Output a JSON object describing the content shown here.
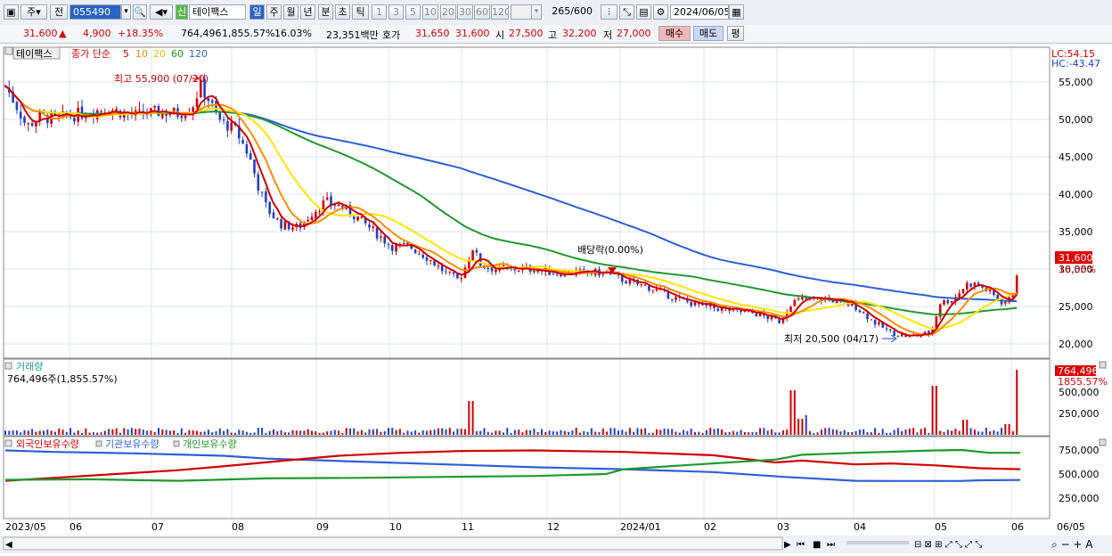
{
  "toolbar": {
    "type_label": "주",
    "prev_label": "전",
    "code_value": "055490",
    "new_label": "신",
    "stock_name": "테이팩스",
    "periods": [
      "일",
      "주",
      "월",
      "년",
      "분",
      "초",
      "틱"
    ],
    "intervals": [
      "1",
      "3",
      "5",
      "10",
      "20",
      "30",
      "60",
      "120"
    ],
    "count": "265",
    "count_total": "/600",
    "date": "2024/06/05"
  },
  "info": {
    "price": "31,600",
    "change_arrow": "▲",
    "change": "4,900",
    "change_pct": "+18.35%",
    "volume": "764,496",
    "volume_pct": "1,855.57%",
    "turnover": "16.03%",
    "amount": "23,351백만",
    "quote_label": "호가",
    "ask": "31,650",
    "bid": "31,600",
    "open_label": "시",
    "open": "27,500",
    "high_label": "고",
    "high": "32,200",
    "low_label": "저",
    "low": "27,000",
    "buy_label": "매수",
    "sell_label": "매도",
    "avg_label": "평"
  },
  "price_panel": {
    "name": "테이팩스",
    "legend_prefix": "종가 단순",
    "ma": [
      {
        "label": "5",
        "color": "#d00000"
      },
      {
        "label": "10",
        "color": "#e6a000"
      },
      {
        "label": "20",
        "color": "#e6d600"
      },
      {
        "label": "60",
        "color": "#1a9a1a"
      },
      {
        "label": "120",
        "color": "#2e5fd8"
      }
    ],
    "lc": "LC:54.15",
    "hc": "HC:-43.47",
    "high_note": "최고 55,900 (07/20)",
    "low_note": "최저 20,500 (04/17)",
    "div_note": "배당락(0.00%)",
    "current_price": "31,600",
    "current_pct": "18.35%",
    "y_ticks": [
      "55,000",
      "50,000",
      "45,000",
      "40,000",
      "35,000",
      "30,000",
      "25,000",
      "20,000"
    ]
  },
  "volume_panel": {
    "title": "거래량",
    "value": "764,496주(1,855.57%)",
    "current": "764,496",
    "current_pct": "1855.57%",
    "y_ticks": [
      "500,000",
      "250,000"
    ]
  },
  "holding_panel": {
    "items": [
      "외국인보유수량",
      "기관보유수량",
      "개인보유수량"
    ],
    "y_ticks": [
      "750,000",
      "500,000",
      "250,000"
    ]
  },
  "x_labels": [
    "2023/05",
    "06",
    "07",
    "08",
    "09",
    "10",
    "11",
    "12",
    "2024/01",
    "02",
    "03",
    "04",
    "05",
    "06",
    "06/05"
  ],
  "colors": {
    "up": "#d00000",
    "down": "#1e3fd0",
    "ma5": "#d00000",
    "ma10": "#ff8c00",
    "ma20": "#ffe500",
    "ma60": "#1f9a2e",
    "ma120": "#2e5fd8",
    "foreign": "#2e5fd8",
    "inst": "#d00000",
    "indiv": "#1f9a2e"
  }
}
